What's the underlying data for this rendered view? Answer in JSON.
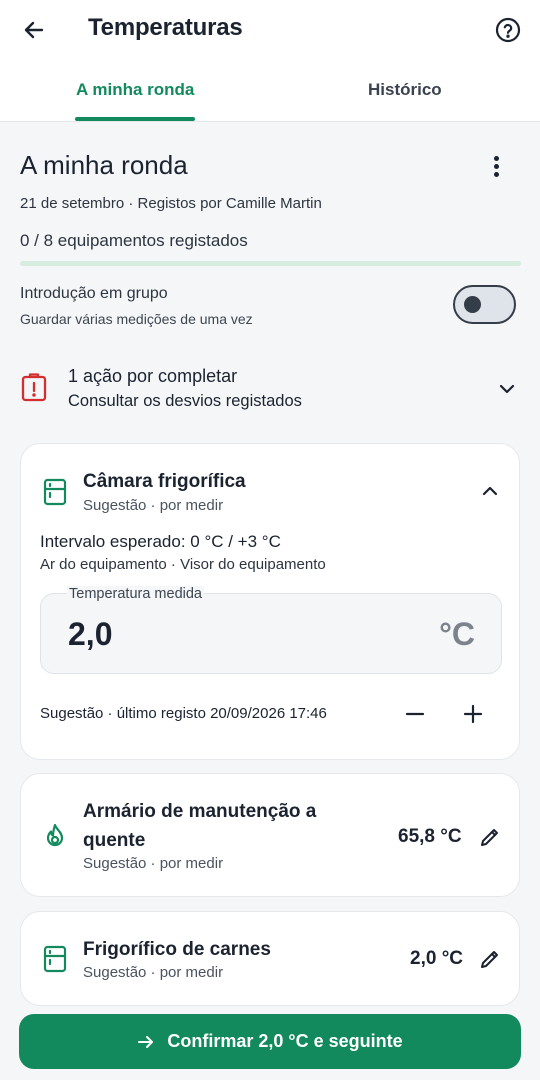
{
  "header": {
    "title": "Temperaturas",
    "back_icon": "arrow-left-icon",
    "help_icon": "help-circle-icon"
  },
  "tabs": [
    {
      "label": "A minha ronda",
      "active": true
    },
    {
      "label": "Histórico",
      "active": false
    }
  ],
  "round": {
    "title": "A minha ronda",
    "meta": "21 de setembro · Registos por Camille Martin",
    "progress_text": "0 / 8 equipamentos registados",
    "progress_fraction": 0
  },
  "group_entry": {
    "label": "Introdução em grupo",
    "sublabel": "Guardar várias medições de uma vez",
    "enabled": false
  },
  "alert": {
    "title": "1 ação por completar",
    "subtitle": "Consultar os desvios registados",
    "icon": "alert-clipboard-icon"
  },
  "equipment": [
    {
      "name": "Câmara frigorífica",
      "subtitle": "Sugestão · por medir",
      "icon": "fridge-icon",
      "range": "Intervalo esperado: 0 °C / +3 °C",
      "range_sub": "Ar do equipamento · Visor do equipamento",
      "temp_label": "Temperatura medida",
      "temp_value": "2,0",
      "temp_unit": "°C",
      "last_record": "Sugestão · último registo 20/09/2026 17:46"
    },
    {
      "name_line1": "Armário de manutenção a",
      "name_line2": "quente",
      "subtitle": "Sugestão · por medir",
      "icon": "flame-icon",
      "value": "65,8 °C"
    },
    {
      "name": "Frigorífico de carnes",
      "subtitle": "Sugestão · por medir",
      "icon": "fridge-icon",
      "value": "2,0 °C"
    }
  ],
  "confirm": {
    "label": "Confirmar 2,0 °C e seguinte"
  },
  "colors": {
    "accent": "#138a5e",
    "alert": "#d32f2f",
    "text": "#1b2330",
    "background": "#f5f6f8"
  }
}
